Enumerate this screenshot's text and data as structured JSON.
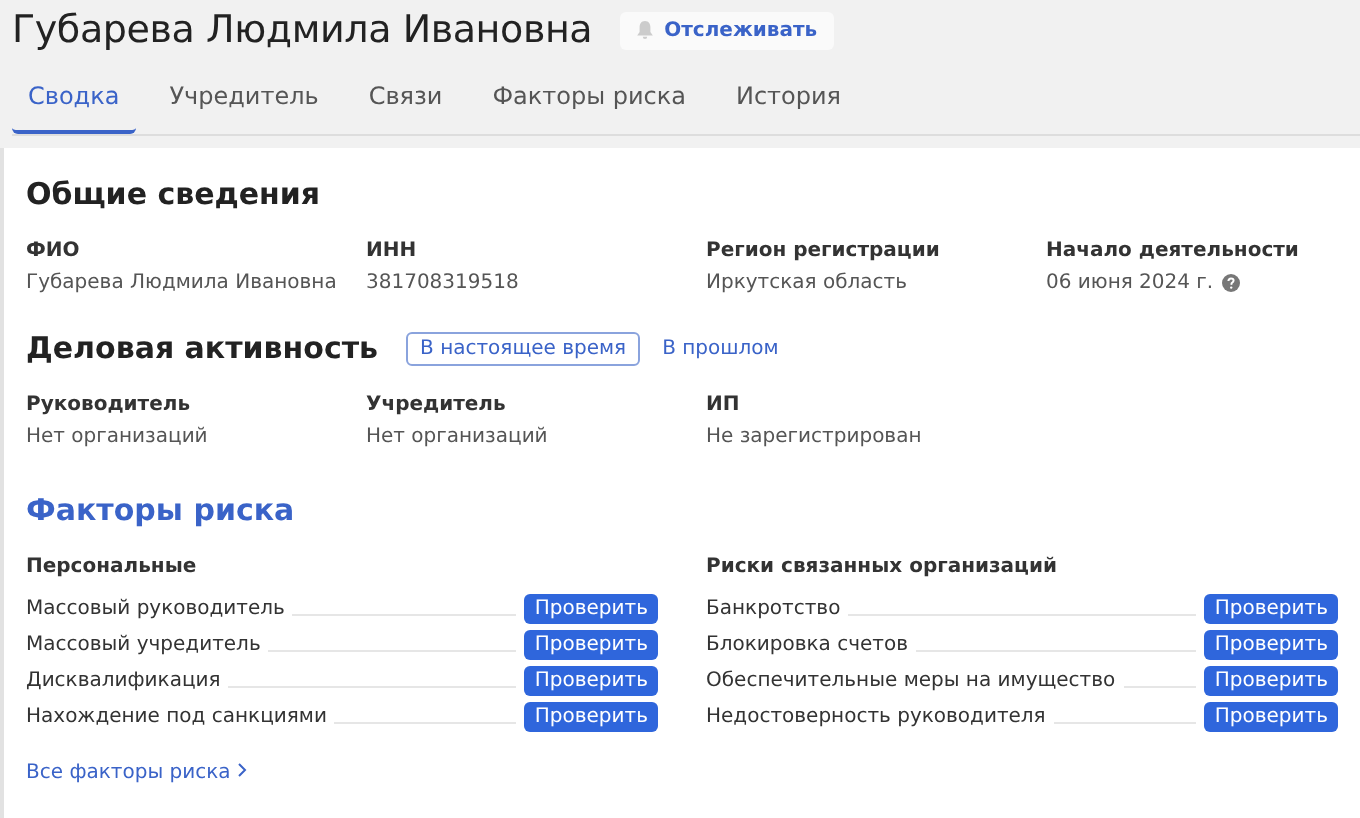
{
  "person": {
    "name": "Губарева Людмила Ивановна",
    "follow_button": "Отслеживать"
  },
  "tabs": [
    {
      "label": "Сводка",
      "selected": true
    },
    {
      "label": "Учредитель",
      "selected": false
    },
    {
      "label": "Связи",
      "selected": false
    },
    {
      "label": "Факторы риска",
      "selected": false
    },
    {
      "label": "История",
      "selected": false
    }
  ],
  "general": {
    "title": "Общие сведения",
    "fields": [
      {
        "label": "ФИО",
        "value": "Губарева Людмила Ивановна",
        "help": false
      },
      {
        "label": "ИНН",
        "value": "381708319518",
        "help": false
      },
      {
        "label": "Регион регистрации",
        "value": "Иркутская область",
        "help": false
      },
      {
        "label": "Начало деятельности",
        "value": "06 июня 2024 г.",
        "help": true
      }
    ]
  },
  "activity": {
    "title": "Деловая активность",
    "toggles": [
      {
        "label": "В настоящее время",
        "selected": true
      },
      {
        "label": "В прошлом",
        "selected": false
      }
    ],
    "fields": [
      {
        "label": "Руководитель",
        "value": "Нет организаций"
      },
      {
        "label": "Учредитель",
        "value": "Нет организаций"
      },
      {
        "label": "ИП",
        "value": "Не зарегистрирован"
      }
    ]
  },
  "risks": {
    "title": "Факторы риска",
    "groups": [
      {
        "title": "Персональные",
        "items": [
          {
            "label": "Массовый руководитель",
            "button": "Проверить"
          },
          {
            "label": "Массовый учредитель",
            "button": "Проверить"
          },
          {
            "label": "Дисквалификация",
            "button": "Проверить"
          },
          {
            "label": "Нахождение под санкциями",
            "button": "Проверить"
          }
        ]
      },
      {
        "title": "Риски связанных организаций",
        "items": [
          {
            "label": "Банкротство",
            "button": "Проверить"
          },
          {
            "label": "Блокировка счетов",
            "button": "Проверить"
          },
          {
            "label": "Обеспечительные меры на имущество",
            "button": "Проверить"
          },
          {
            "label": "Недостоверность руководителя",
            "button": "Проверить"
          }
        ]
      }
    ],
    "all_link": "Все факторы риска"
  }
}
